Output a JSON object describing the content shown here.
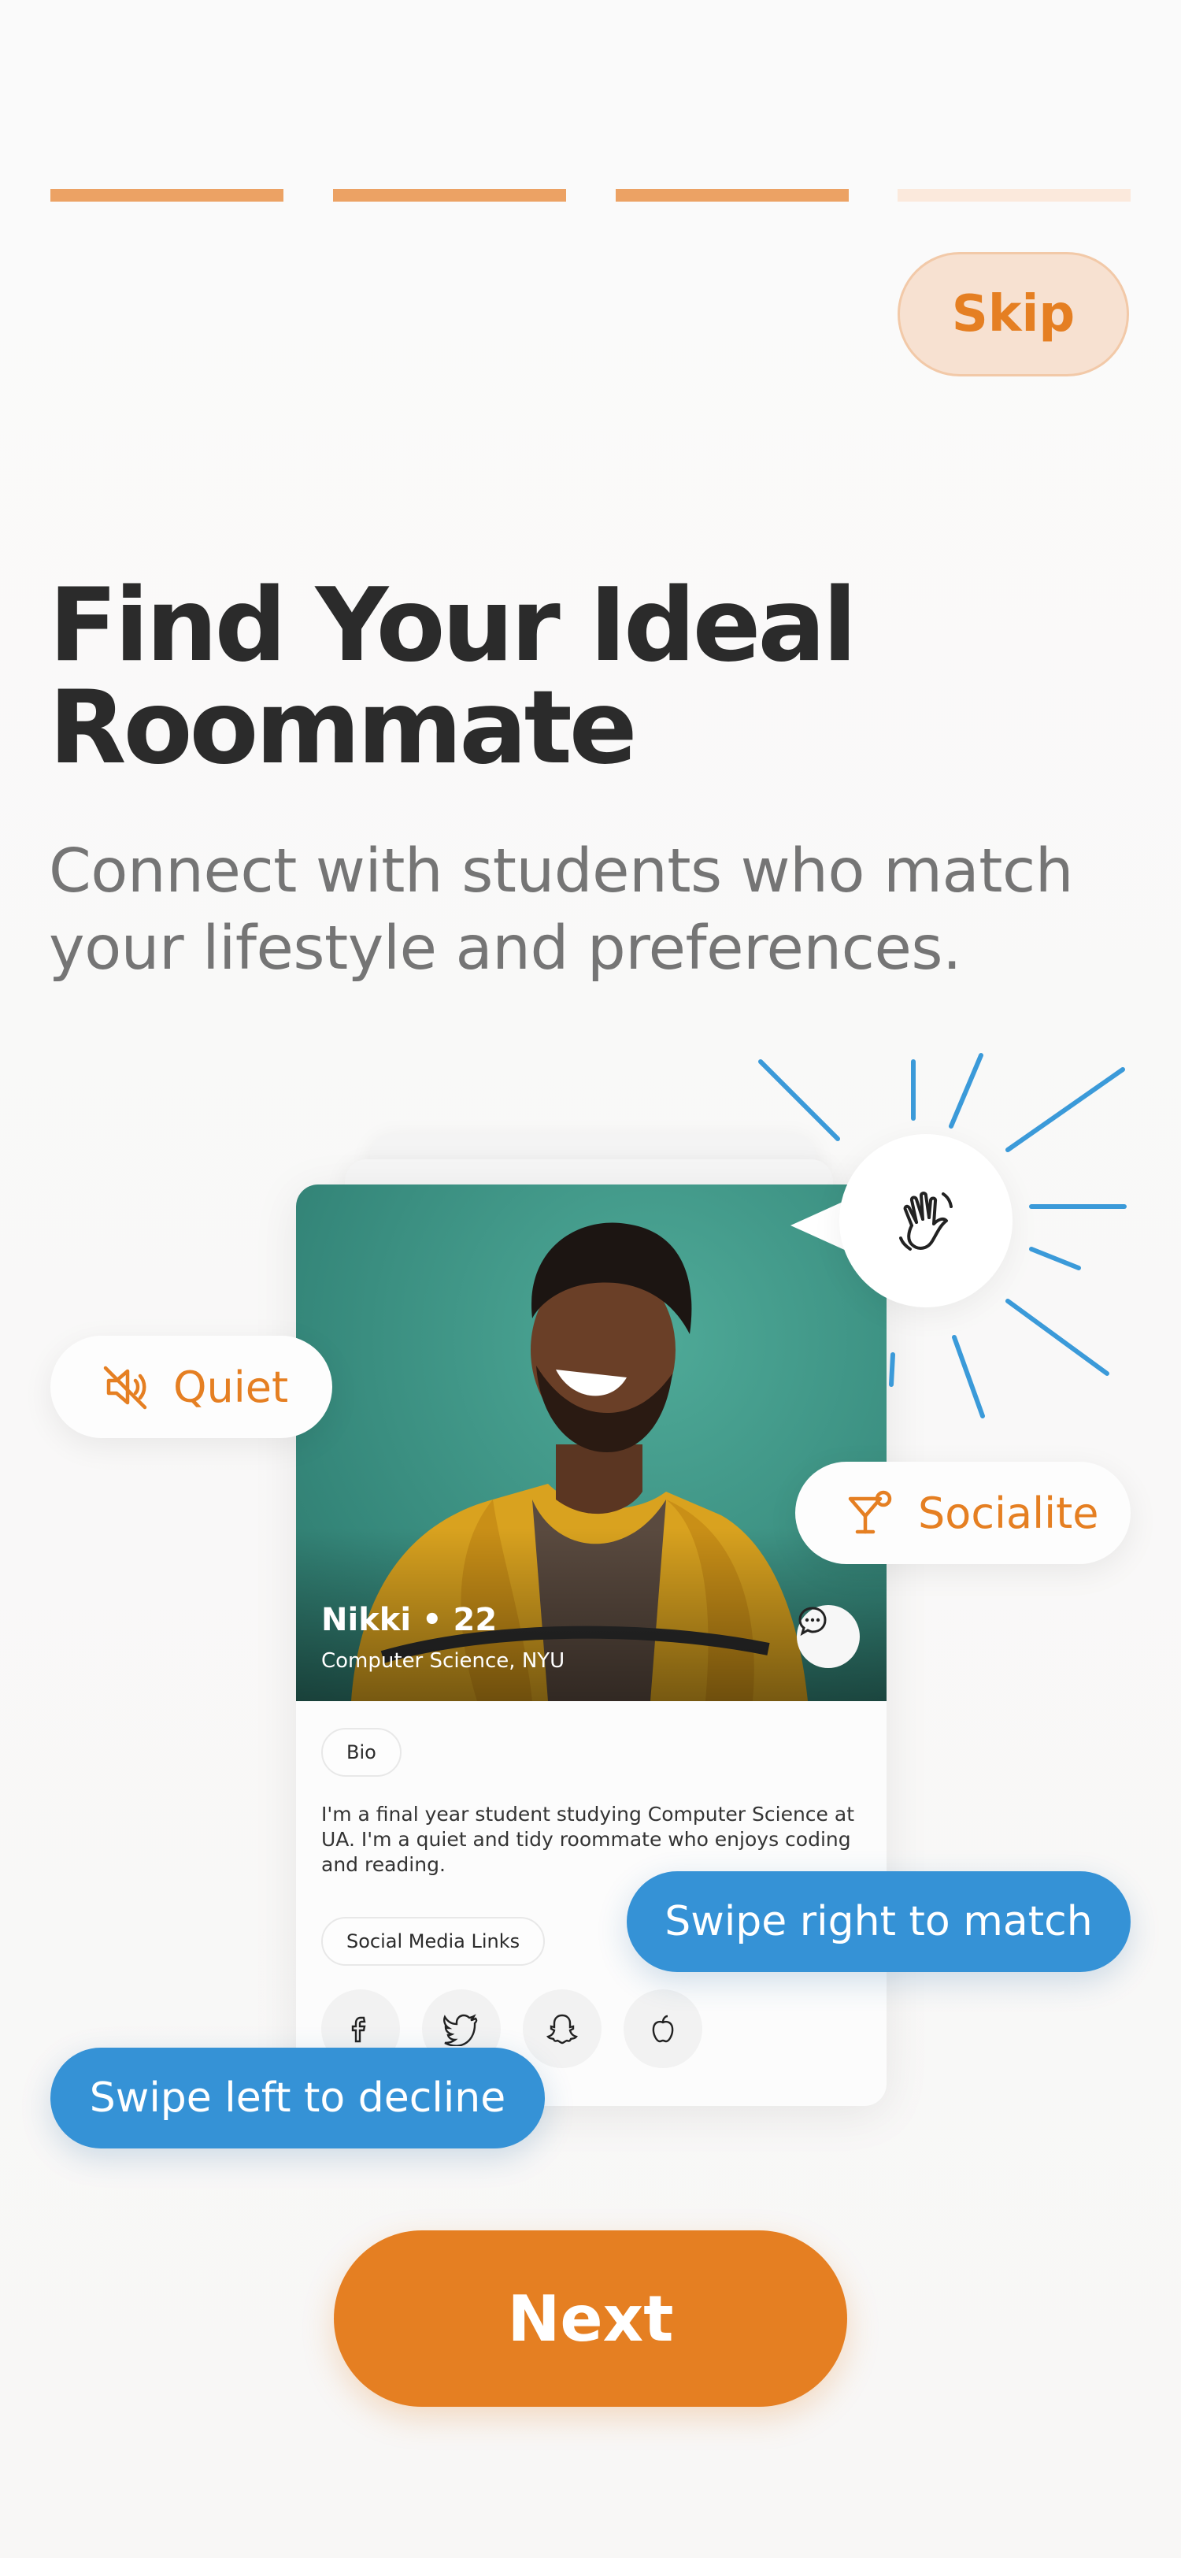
{
  "progress": {
    "total_steps": 4,
    "completed_steps": 3,
    "active_color": "#eca264",
    "inactive_color": "#fbe9dc"
  },
  "header": {
    "skip_label": "Skip"
  },
  "onboarding": {
    "title": "Find Your Ideal Roommate",
    "subtitle": "Connect with students who match your lifestyle and preferences."
  },
  "profile_card": {
    "name_age": "Nikki • 22",
    "major": "Computer Science, NYU",
    "bio_chip": "Bio",
    "bio_text": "I'm a final year student studying Computer Science at UA. I'm a quiet and tidy roommate who enjoys coding and reading.",
    "social_chip": "Social Media Links",
    "social_icons": [
      "facebook-icon",
      "twitter-icon",
      "snapchat-icon",
      "apple-icon"
    ]
  },
  "traits": {
    "quiet": "Quiet",
    "socialite": "Socialite"
  },
  "hints": {
    "swipe_right": "Swipe right to match",
    "swipe_left": "Swipe left to decline"
  },
  "footer": {
    "next_label": "Next"
  },
  "colors": {
    "accent": "#e57f22",
    "hint_blue": "#3592d6",
    "title": "#2b2b2b",
    "subtitle": "#757575"
  }
}
